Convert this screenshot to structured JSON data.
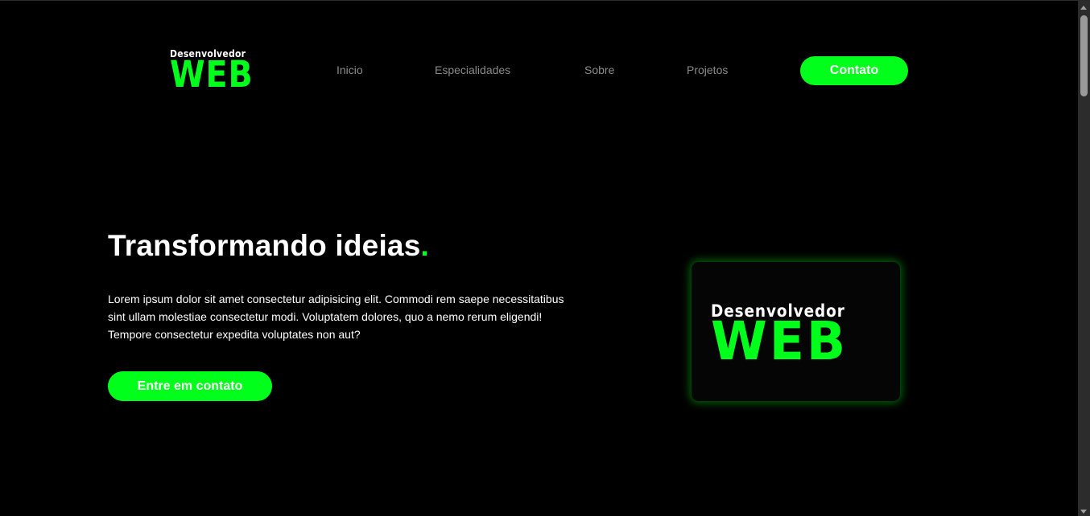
{
  "header": {
    "logo_line1": "Desenvolvedor",
    "logo_line2": "WEB",
    "nav": {
      "inicio": "Inicio",
      "especialidades": "Especialidades",
      "sobre": "Sobre",
      "projetos": "Projetos"
    },
    "contact_button": "Contato"
  },
  "hero": {
    "title": "Transformando ideias",
    "title_dot": ".",
    "description": "Lorem ipsum dolor sit amet consectetur adipisicing elit. Commodi rem saepe necessitatibus sint ullam molestiae consectetur modi. Voluptatem dolores, quo a nemo rerum eligendi! Tempore consectetur expedita voluptates non aut?",
    "cta_button": "Entre em contato",
    "card_logo_line1": "Desenvolvedor",
    "card_logo_line2": "WEB"
  },
  "colors": {
    "accent": "#00ff1a",
    "background": "#000000",
    "nav_text": "#8a8a8a"
  }
}
